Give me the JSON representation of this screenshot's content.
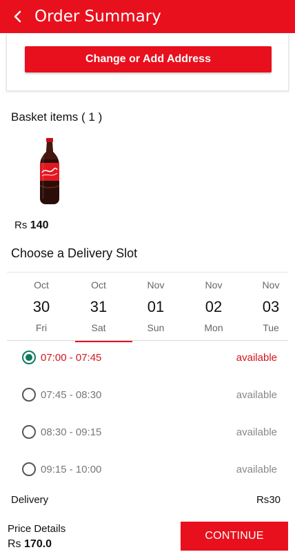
{
  "header": {
    "title": "Order Summary",
    "back_icon": "chevron-left-icon"
  },
  "address": {
    "button_label": "Change or Add Address"
  },
  "basket": {
    "title": "Basket items ( 1 )",
    "items": [
      {
        "image": "coca-cola-bottle",
        "currency": "Rs",
        "price": "140"
      }
    ]
  },
  "delivery_slot": {
    "title": "Choose a Delivery Slot",
    "dates": [
      {
        "month": "Oct",
        "day": "30",
        "weekday": "Fri"
      },
      {
        "month": "Oct",
        "day": "31",
        "weekday": "Sat",
        "selected": true
      },
      {
        "month": "Nov",
        "day": "01",
        "weekday": "Sun"
      },
      {
        "month": "Nov",
        "day": "02",
        "weekday": "Mon"
      },
      {
        "month": "Nov",
        "day": "03",
        "weekday": "Tue"
      }
    ],
    "slots": [
      {
        "time": "07:00 - 07:45",
        "status": "available",
        "selected": true
      },
      {
        "time": "07:45 - 08:30",
        "status": "available"
      },
      {
        "time": "08:30 - 09:15",
        "status": "available"
      },
      {
        "time": "09:15 - 10:00",
        "status": "available"
      }
    ]
  },
  "delivery": {
    "label": "Delivery",
    "currency": "Rs",
    "fee": "30"
  },
  "footer": {
    "price_details_label": "Price Details",
    "currency": "Rs",
    "total": "170.0",
    "continue_label": "CONTINUE"
  },
  "colors": {
    "brand_red": "#e8101d",
    "radio_green": "#0f7a5c",
    "slot_active_text": "#d2141c"
  }
}
